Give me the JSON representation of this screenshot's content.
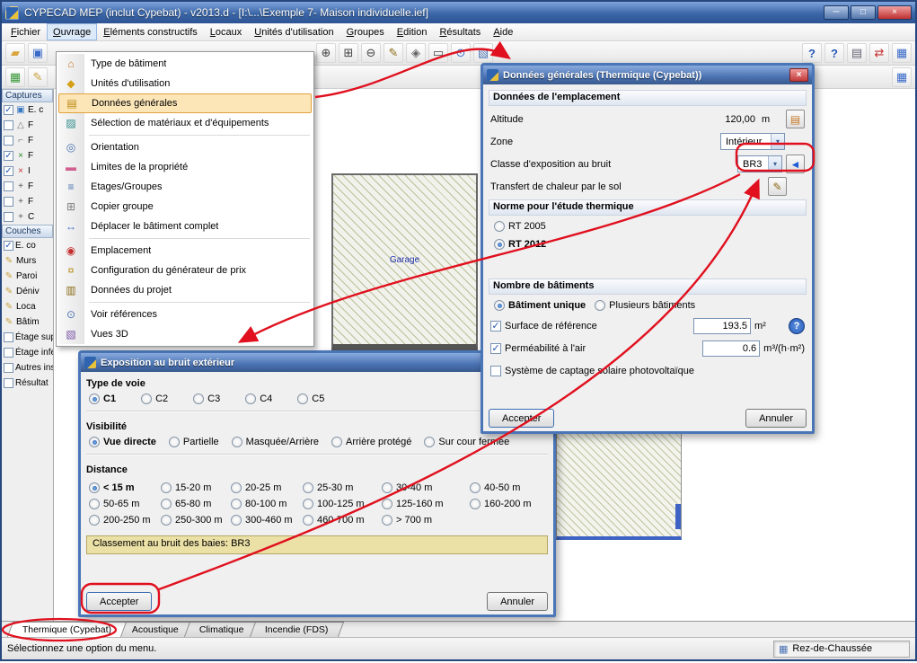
{
  "window": {
    "title": "CYPECAD MEP (inclut Cypebat) - v2013.d - [I:\\...\\Exemple 7- Maison individuelle.ief]",
    "controls": {
      "minimize": "─",
      "maximize": "□",
      "close": "×"
    }
  },
  "glyphs": {
    "dropdown": "▾",
    "check": "✓",
    "close": "×",
    "pencil": "✎",
    "help": "?",
    "left_arrow": "◄",
    "levels": "▤",
    "status_icon": "▦"
  },
  "menubar": {
    "items": [
      "Fichier",
      "Ouvrage",
      "Eléments constructifs",
      "Locaux",
      "Unités d'utilisation",
      "Groupes",
      "Edition",
      "Résultats",
      "Aide"
    ]
  },
  "toolbar": {
    "row1_left": [
      {
        "name": "open",
        "glyph": "▰",
        "style": "color:#D9A43B"
      },
      {
        "name": "save",
        "glyph": "▣",
        "style": "color:#3A6BC9"
      }
    ],
    "row1_mid": [
      {
        "name": "zoom-in",
        "glyph": "⊕",
        "style": "color:#444"
      },
      {
        "name": "zoom-window",
        "glyph": "⊞",
        "style": "color:#444"
      },
      {
        "name": "zoom-out",
        "glyph": "⊖",
        "style": "color:#444"
      },
      {
        "name": "edit",
        "glyph": "✎",
        "style": "color:#8B6914"
      },
      {
        "name": "pan",
        "glyph": "◈",
        "style": "color:#666"
      },
      {
        "name": "window-frame",
        "glyph": "▭",
        "style": "color:#444"
      },
      {
        "name": "search",
        "glyph": "⊙",
        "style": "color:#3A6BC9"
      },
      {
        "name": "layers",
        "glyph": "▧",
        "style": "color:#4A72B2"
      }
    ],
    "row1_right": [
      {
        "name": "help",
        "glyph": "?",
        "style": "color:#2458B8;font-weight:bold"
      },
      {
        "name": "context-help",
        "glyph": "?",
        "style": "color:#2458B8;font-weight:bold"
      },
      {
        "name": "print",
        "glyph": "▤",
        "style": "color:#667"
      },
      {
        "name": "transfer",
        "glyph": "⇄",
        "style": "color:#C43030"
      },
      {
        "name": "grid",
        "glyph": "▦",
        "style": "color:#3A6BC9"
      }
    ],
    "row2_left": [
      {
        "name": "captures-layer",
        "glyph": "▦",
        "style": "color:#3A9A3A"
      },
      {
        "name": "edit-layer",
        "glyph": "✎",
        "style": "color:#C8A23C"
      }
    ],
    "row2_right": [
      {
        "name": "ortho-grid",
        "glyph": "▦",
        "style": "color:#3A6BC9"
      }
    ]
  },
  "ouvrage_menu": {
    "items": [
      {
        "label": "Type de bâtiment",
        "glyph": "⌂",
        "style": "color:#C87828"
      },
      {
        "label": "Unités d'utilisation",
        "glyph": "◆",
        "style": "color:#D4A017"
      },
      {
        "label": "Données générales",
        "glyph": "▤",
        "style": "color:#B8860B"
      },
      {
        "label": "Sélection de matériaux et d'équipements",
        "glyph": "▨",
        "style": "color:#2E8B8B"
      },
      {
        "label": "Orientation",
        "glyph": "◎",
        "style": "color:#4A72B2"
      },
      {
        "label": "Limites de la propriété",
        "glyph": "▬",
        "style": "color:#D06090"
      },
      {
        "label": "Etages/Groupes",
        "glyph": "≡",
        "style": "color:#4A72B2"
      },
      {
        "label": "Copier groupe",
        "glyph": "⊞",
        "style": "color:#808080"
      },
      {
        "label": "Déplacer le bâtiment complet",
        "glyph": "↔",
        "style": "color:#3A6BC9"
      },
      {
        "label": "Emplacement",
        "glyph": "◉",
        "style": "color:#C43030"
      },
      {
        "label": "Configuration du générateur de prix",
        "glyph": "¤",
        "style": "color:#B8860B"
      },
      {
        "label": "Données du projet",
        "glyph": "▥",
        "style": "color:#8B6914"
      },
      {
        "label": "Voir références",
        "glyph": "⊙",
        "style": "color:#4A72B2"
      },
      {
        "label": "Vues 3D",
        "glyph": "▧",
        "style": "color:#7A52A8"
      }
    ]
  },
  "sidebar": {
    "captures": {
      "title": "Captures",
      "items": [
        {
          "label": "E. c",
          "glyph": "▣",
          "style": "color:#3A78C2"
        },
        {
          "label": "F",
          "glyph": "△",
          "style": "color:#777"
        },
        {
          "label": "F",
          "glyph": "⌐",
          "style": "color:#777"
        },
        {
          "label": "F",
          "glyph": "×",
          "style": "color:#2A8A2A"
        },
        {
          "label": "I",
          "glyph": "×",
          "style": "color:#C43030"
        },
        {
          "label": "F",
          "glyph": "+",
          "style": "color:#555"
        },
        {
          "label": "F",
          "glyph": "+",
          "style": "color:#555"
        },
        {
          "label": "C",
          "glyph": "+",
          "style": "color:#555"
        }
      ]
    },
    "couches": {
      "title": "Couches",
      "items": [
        {
          "label": "E. co"
        },
        {
          "label": "Murs"
        },
        {
          "label": "Paroi"
        },
        {
          "label": "Déniv"
        },
        {
          "label": "Loca"
        },
        {
          "label": "Bâtim"
        },
        {
          "label": "Étage supe"
        },
        {
          "label": "Étage infér"
        },
        {
          "label": "Autres inst"
        },
        {
          "label": "Résultat"
        }
      ]
    }
  },
  "canvas": {
    "garage_label": "Garage"
  },
  "dialog_general": {
    "title": "Données générales (Thermique (Cypebat))",
    "section_emplacement": "Données de l'emplacement",
    "altitude_label": "Altitude",
    "altitude_value": "120,00",
    "altitude_unit": "m",
    "zone_label": "Zone",
    "zone_value": "Intérieur",
    "classe_label": "Classe d'exposition au bruit",
    "classe_value": "BR3",
    "transfert_label": "Transfert de chaleur par le sol",
    "section_norme": "Norme pour l'étude thermique",
    "norme_rt2005": "RT 2005",
    "norme_rt2012": "RT 2012",
    "section_batiments": "Nombre de bâtiments",
    "batiment_unique": "Bâtiment unique",
    "batiments_plusieurs": "Plusieurs bâtiments",
    "surface_label": "Surface de référence",
    "surface_value": "193.5",
    "surface_unit": "m²",
    "permeabilite_label": "Perméabilité à l'air",
    "permeabilite_value": "0.6",
    "permeabilite_unit": "m³/(h·m²)",
    "solaire_label": "Système de captage solaire photovoltaïque",
    "accept_label": "Accepter",
    "cancel_label": "Annuler"
  },
  "dialog_exposition": {
    "title": "Exposition au bruit extérieur",
    "type_voie_label": "Type de voie",
    "type_voie_options": [
      "C1",
      "C2",
      "C3",
      "C4",
      "C5"
    ],
    "visibilite_label": "Visibilité",
    "visibilite_options": [
      "Vue directe",
      "Partielle",
      "Masquée/Arrière",
      "Arrière protégé",
      "Sur cour fermée"
    ],
    "distance_label": "Distance",
    "distance_options": [
      "< 15 m",
      "15-20 m",
      "20-25 m",
      "25-30 m",
      "30-40 m",
      "40-50 m",
      "50-65 m",
      "65-80 m",
      "80-100 m",
      "100-125 m",
      "125-160 m",
      "160-200 m",
      "200-250 m",
      "250-300 m",
      "300-460 m",
      "460-700 m",
      "> 700 m"
    ],
    "info": "Classement au bruit des baies: BR3",
    "accept_label": "Accepter",
    "cancel_label": "Annuler"
  },
  "tabs": {
    "items": [
      "Thermique (Cypebat)",
      "Acoustique",
      "Climatique",
      "Incendie (FDS)"
    ]
  },
  "statusbar": {
    "message": "Sélectionnez une option du menu.",
    "level": "Rez-de-Chaussée"
  }
}
